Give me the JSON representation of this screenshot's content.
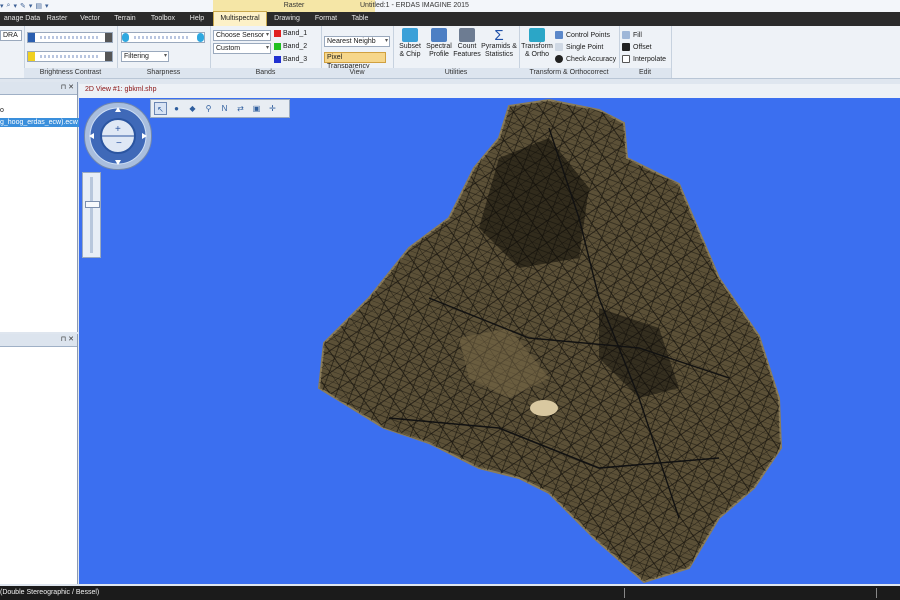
{
  "window_title": "Untitled:1 - ERDAS IMAGINE 2015",
  "context_tab": "Raster",
  "tabs": [
    "anage Data",
    "Raster",
    "Vector",
    "Terrain",
    "Toolbox",
    "Help",
    "Multispectral",
    "Drawing",
    "Format",
    "Table"
  ],
  "active_tab": "Multispectral",
  "ribbon": {
    "dra_label": "DRA",
    "groups": {
      "brightness_contrast": "Brightness Contrast",
      "sharpness": "Sharpness",
      "bands": "Bands",
      "view": "View",
      "utilities": "Utilities",
      "transform": "Transform & Orthocorrect",
      "edit": "Edit"
    },
    "filtering_label": "Filtering",
    "sensor_value": "Choose Sensor",
    "custom_value": "Custom",
    "bands": [
      {
        "label": "Band_1",
        "color": "#e02020"
      },
      {
        "label": "Band_2",
        "color": "#20c020"
      },
      {
        "label": "Band_3",
        "color": "#2030d0"
      }
    ],
    "resample_value": "Nearest Neighb",
    "pixel_transparency": "Pixel Transparency",
    "subset": [
      "Subset",
      "& Chip"
    ],
    "spectral": [
      "Spectral",
      "Profile"
    ],
    "count": [
      "Count",
      "Features"
    ],
    "pyramids": [
      "Pyramids &",
      "Statistics"
    ],
    "transform": [
      "Transform",
      "& Ortho"
    ],
    "control_points": "Control Points",
    "single_point": "Single Point",
    "check_accuracy": "Check Accuracy",
    "fill": "Fill",
    "offset": "Offset",
    "interpolate": "Interpolate"
  },
  "contents": {
    "node_label": "o",
    "layer": "g_hoog_erdas_ecw).ecw"
  },
  "view": {
    "title": "2D View #1: gbkml.shp"
  },
  "status": {
    "projection": "(Double Stereographic / Bessel)"
  },
  "colors": {
    "view_background": "#3b6ff0",
    "map_fill": "#5b5037",
    "accent_tab": "#fdf1c7"
  }
}
